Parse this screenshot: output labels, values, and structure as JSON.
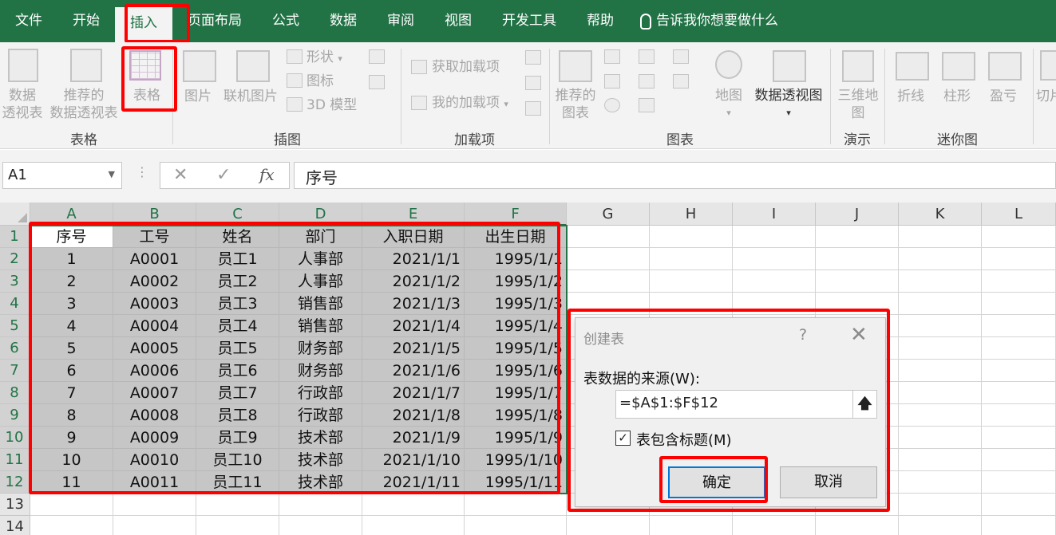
{
  "menu": [
    "文件",
    "开始",
    "插入",
    "页面布局",
    "公式",
    "数据",
    "审阅",
    "视图",
    "开发工具",
    "帮助"
  ],
  "menu_active_index": 2,
  "tell_me": "告诉我你想要做什么",
  "ribbon": {
    "pivot_line1": "数据",
    "pivot_line2": "透视表",
    "rec_pivot_line1": "推荐的",
    "rec_pivot_line2": "数据透视表",
    "table": "表格",
    "picture": "图片",
    "online_picture": "联机图片",
    "shapes": "形状",
    "icons": "图标",
    "model3d": "3D 模型",
    "get_addins": "获取加载项",
    "my_addins": "我的加载项",
    "rec_chart_line1": "推荐的",
    "rec_chart_line2": "图表",
    "map": "地图",
    "pivot_chart": "数据透视图",
    "map3d_line1": "三维地",
    "map3d_line2": "图",
    "spark_line": "折线",
    "spark_column": "柱形",
    "spark_winloss": "盈亏",
    "slicer": "切片",
    "groups": {
      "tables": "表格",
      "illustrations": "插图",
      "addins": "加载项",
      "charts": "图表",
      "tours": "演示",
      "sparklines": "迷你图"
    }
  },
  "formula_bar": {
    "name_box": "A1",
    "content": "序号"
  },
  "columns": [
    "A",
    "B",
    "C",
    "D",
    "E",
    "F",
    "G",
    "H",
    "I",
    "J",
    "K",
    "L"
  ],
  "rows": [
    "1",
    "2",
    "3",
    "4",
    "5",
    "6",
    "7",
    "8",
    "9",
    "10",
    "11",
    "12",
    "13",
    "14"
  ],
  "table": {
    "headers": [
      "序号",
      "工号",
      "姓名",
      "部门",
      "入职日期",
      "出生日期"
    ],
    "rows": [
      [
        "1",
        "A0001",
        "员工1",
        "人事部",
        "2021/1/1",
        "1995/1/1"
      ],
      [
        "2",
        "A0002",
        "员工2",
        "人事部",
        "2021/1/2",
        "1995/1/2"
      ],
      [
        "3",
        "A0003",
        "员工3",
        "销售部",
        "2021/1/3",
        "1995/1/3"
      ],
      [
        "4",
        "A0004",
        "员工4",
        "销售部",
        "2021/1/4",
        "1995/1/4"
      ],
      [
        "5",
        "A0005",
        "员工5",
        "财务部",
        "2021/1/5",
        "1995/1/5"
      ],
      [
        "6",
        "A0006",
        "员工6",
        "财务部",
        "2021/1/6",
        "1995/1/6"
      ],
      [
        "7",
        "A0007",
        "员工7",
        "行政部",
        "2021/1/7",
        "1995/1/7"
      ],
      [
        "8",
        "A0008",
        "员工8",
        "行政部",
        "2021/1/8",
        "1995/1/8"
      ],
      [
        "9",
        "A0009",
        "员工9",
        "技术部",
        "2021/1/9",
        "1995/1/9"
      ],
      [
        "10",
        "A0010",
        "员工10",
        "技术部",
        "2021/1/10",
        "1995/1/10"
      ],
      [
        "11",
        "A0011",
        "员工11",
        "技术部",
        "2021/1/11",
        "1995/1/11"
      ]
    ]
  },
  "dialog": {
    "title": "创建表",
    "help": "?",
    "source_label": "表数据的来源(W):",
    "range": "=$A$1:$F$12",
    "collapse_icon": "collapse-arrow-icon",
    "has_headers_label": "表包含标题(M)",
    "has_headers_checked": true,
    "ok": "确定",
    "cancel": "取消"
  },
  "colors": {
    "excel_green": "#217346",
    "highlight_red": "#ff0000",
    "selection_gray": "#c6c6c6",
    "ok_border": "#0078d7"
  }
}
